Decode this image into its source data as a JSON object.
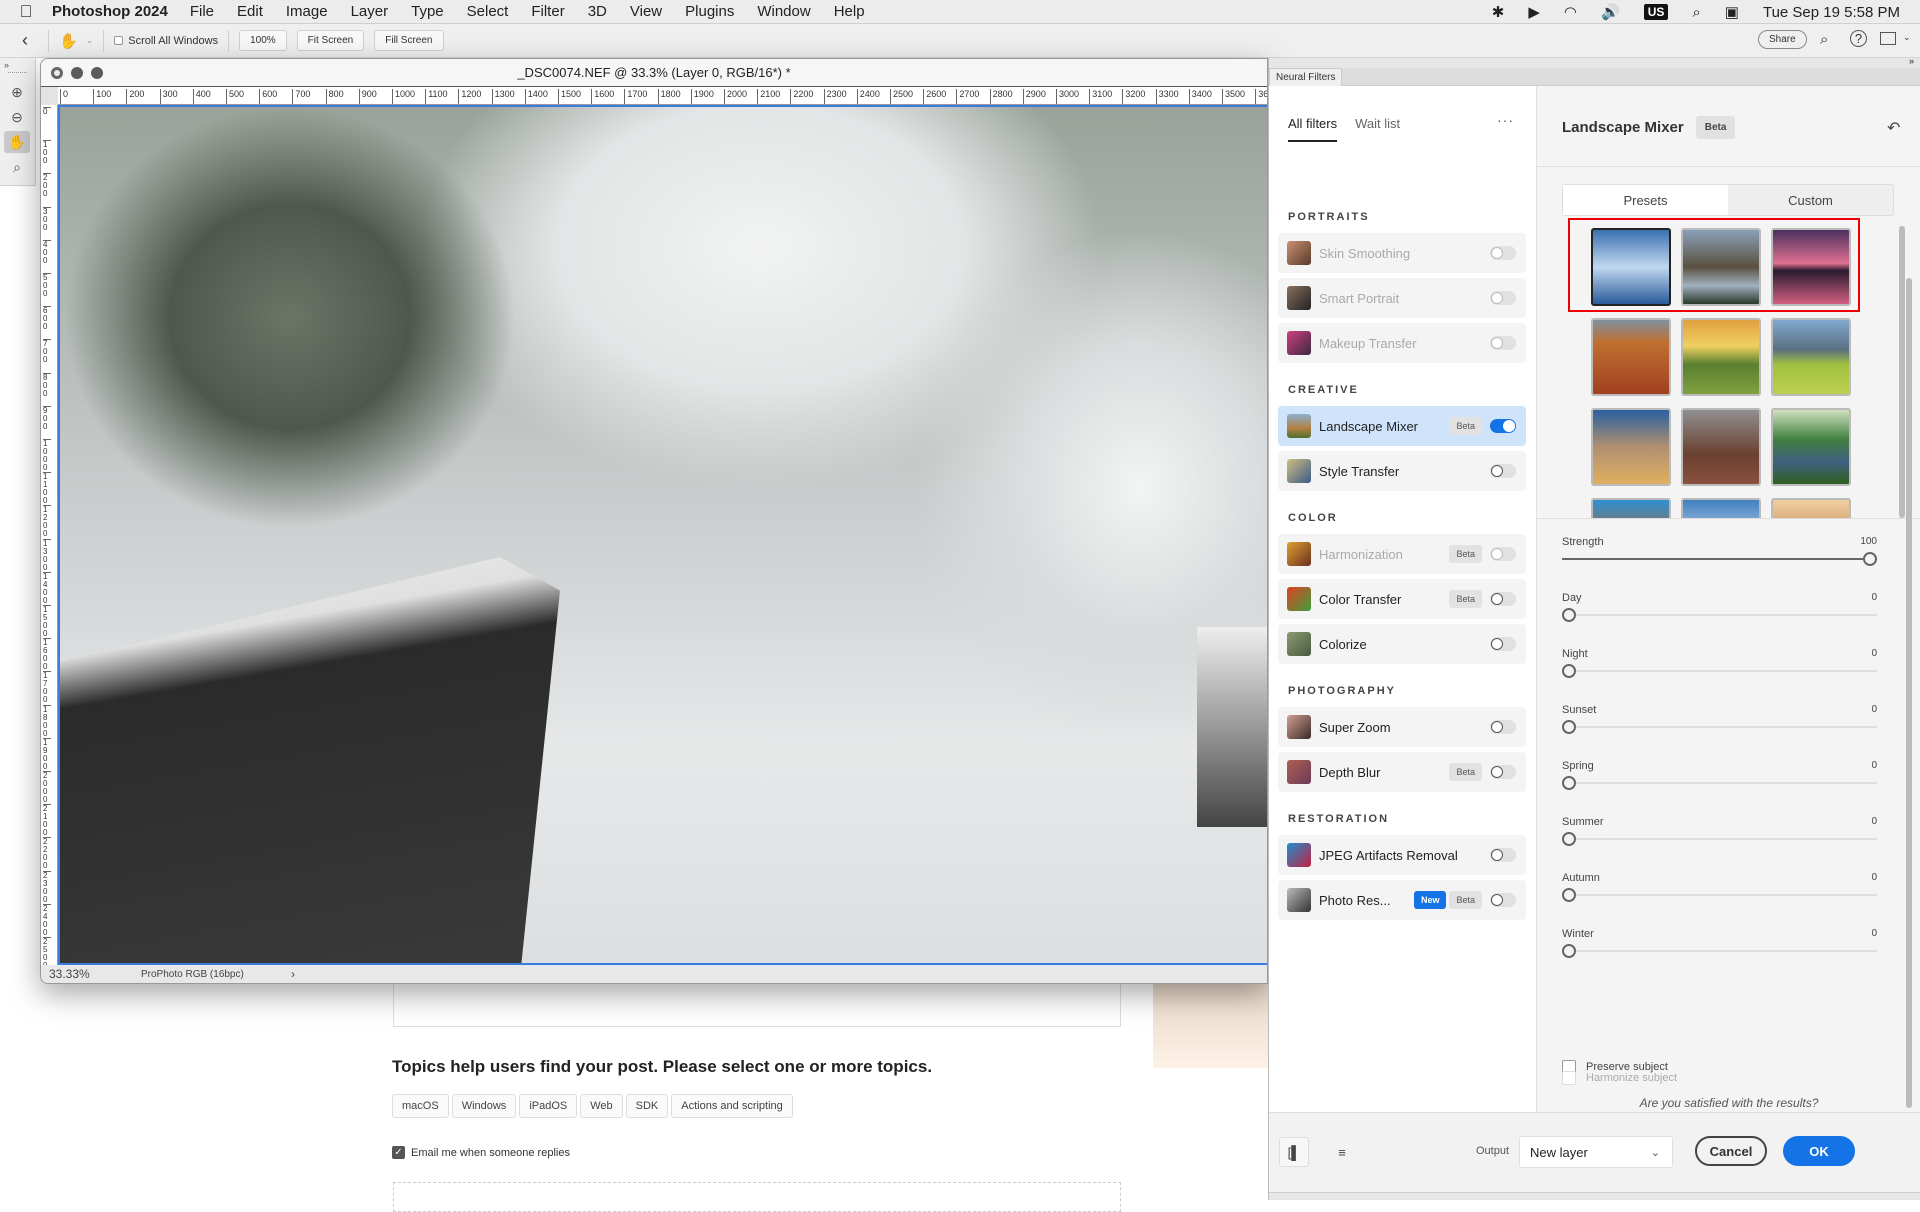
{
  "menubar": {
    "app_name": "Photoshop 2024",
    "items": [
      "File",
      "Edit",
      "Image",
      "Layer",
      "Type",
      "Select",
      "Filter",
      "3D",
      "View",
      "Plugins",
      "Window",
      "Help"
    ],
    "status_icons": [
      "bluetooth-icon",
      "play-circle-icon",
      "wifi-icon",
      "volume-icon",
      "input-source-icon",
      "search-icon",
      "control-center-icon"
    ],
    "input_source": "US",
    "clock": "Tue Sep 19  5:58 PM"
  },
  "options_bar": {
    "scroll_all_windows_label": "Scroll All Windows",
    "scroll_all_windows_checked": false,
    "zoom_100_label": "100%",
    "fit_screen_label": "Fit Screen",
    "fill_screen_label": "Fill Screen",
    "share_label": "Share"
  },
  "document": {
    "title": "_DSC0074.NEF @ 33.3% (Layer 0, RGB/16*) *",
    "ruler_h": [
      "0",
      "100",
      "200",
      "300",
      "400",
      "500",
      "600",
      "700",
      "800",
      "900",
      "1000",
      "1100",
      "1200",
      "1300",
      "1400",
      "1500",
      "1600",
      "1700",
      "1800",
      "1900",
      "2000",
      "2100",
      "2200",
      "2300",
      "2400",
      "2500",
      "2600",
      "2700",
      "2800",
      "2900",
      "3000",
      "3100",
      "3200",
      "3300",
      "3400",
      "3500",
      "36"
    ],
    "ruler_v": [
      "0",
      "100",
      "200",
      "300",
      "400",
      "500",
      "600",
      "700",
      "800",
      "900",
      "1000",
      "1100",
      "1200",
      "1300",
      "1400",
      "1500",
      "1600",
      "1700",
      "1800",
      "1900",
      "2000",
      "2100",
      "2200",
      "2300",
      "2400",
      "2500"
    ],
    "zoom_level": "33.33%",
    "color_profile": "ProPhoto RGB (16bpc)"
  },
  "forum_page": {
    "topics_heading": "Topics help users find your post. Please select one or more topics.",
    "topics": [
      "macOS",
      "Windows",
      "iPadOS",
      "Web",
      "SDK",
      "Actions and scripting"
    ],
    "email_label": "Email me when someone replies",
    "email_checked": true
  },
  "neural_filters": {
    "panel_tab": "Neural Filters",
    "tabs": [
      "All filters",
      "Wait list"
    ],
    "active_tab": "All filters",
    "categories": [
      {
        "name": "PORTRAITS",
        "filters": [
          {
            "name": "Skin Smoothing",
            "beta": false,
            "new": false,
            "enabled": false,
            "available": false
          },
          {
            "name": "Smart Portrait",
            "beta": false,
            "new": false,
            "enabled": false,
            "available": false
          },
          {
            "name": "Makeup Transfer",
            "beta": false,
            "new": false,
            "enabled": false,
            "available": false
          }
        ]
      },
      {
        "name": "CREATIVE",
        "filters": [
          {
            "name": "Landscape Mixer",
            "beta": true,
            "new": false,
            "enabled": true,
            "available": true
          },
          {
            "name": "Style Transfer",
            "beta": false,
            "new": false,
            "enabled": false,
            "available": true
          }
        ]
      },
      {
        "name": "COLOR",
        "filters": [
          {
            "name": "Harmonization",
            "beta": true,
            "new": false,
            "enabled": false,
            "available": false
          },
          {
            "name": "Color Transfer",
            "beta": true,
            "new": false,
            "enabled": false,
            "available": true
          },
          {
            "name": "Colorize",
            "beta": false,
            "new": false,
            "enabled": false,
            "available": true
          }
        ]
      },
      {
        "name": "PHOTOGRAPHY",
        "filters": [
          {
            "name": "Super Zoom",
            "beta": false,
            "new": false,
            "enabled": false,
            "available": true
          },
          {
            "name": "Depth Blur",
            "beta": true,
            "new": false,
            "enabled": false,
            "available": true
          }
        ]
      },
      {
        "name": "RESTORATION",
        "filters": [
          {
            "name": "JPEG Artifacts Removal",
            "beta": false,
            "new": false,
            "enabled": false,
            "available": true
          },
          {
            "name": "Photo Res...",
            "beta": true,
            "new": true,
            "enabled": false,
            "available": true
          }
        ]
      }
    ],
    "badge_beta": "Beta",
    "badge_new": "New",
    "settings": {
      "title": "Landscape Mixer",
      "badge": "Beta",
      "modes": [
        "Presets",
        "Custom"
      ],
      "active_mode": "Presets",
      "presets": [
        "snowy-mountain-lake",
        "mountain-valley-river",
        "pink-sunset-peak",
        "desert-canyon",
        "sunrise-green-hills",
        "alpine-meadow",
        "desert-mesa",
        "monument-valley",
        "green-river-valley",
        "autumn-forest",
        "snowy-peaks",
        "golden-cliffs"
      ],
      "selected_preset": 0,
      "sliders": [
        {
          "label": "Strength",
          "value": 100,
          "max": 100
        },
        {
          "label": "Day",
          "value": 0,
          "max": 100
        },
        {
          "label": "Night",
          "value": 0,
          "max": 100
        },
        {
          "label": "Sunset",
          "value": 0,
          "max": 100
        },
        {
          "label": "Spring",
          "value": 0,
          "max": 100
        },
        {
          "label": "Summer",
          "value": 0,
          "max": 100
        },
        {
          "label": "Autumn",
          "value": 0,
          "max": 100
        },
        {
          "label": "Winter",
          "value": 0,
          "max": 100
        }
      ],
      "preserve_subject_label": "Preserve subject",
      "preserve_subject_checked": false,
      "harmonize_subject_label": "Harmonize subject",
      "harmonize_subject_checked": false,
      "satisfied_prompt": "Are you satisfied with the results?"
    },
    "footer": {
      "output_label": "Output",
      "output_value": "New layer",
      "cancel_label": "Cancel",
      "ok_label": "OK"
    }
  },
  "colors": {
    "accent": "#1473e6",
    "selection_highlight": "#cfe3fb",
    "preset_highlight": "#e00000"
  }
}
